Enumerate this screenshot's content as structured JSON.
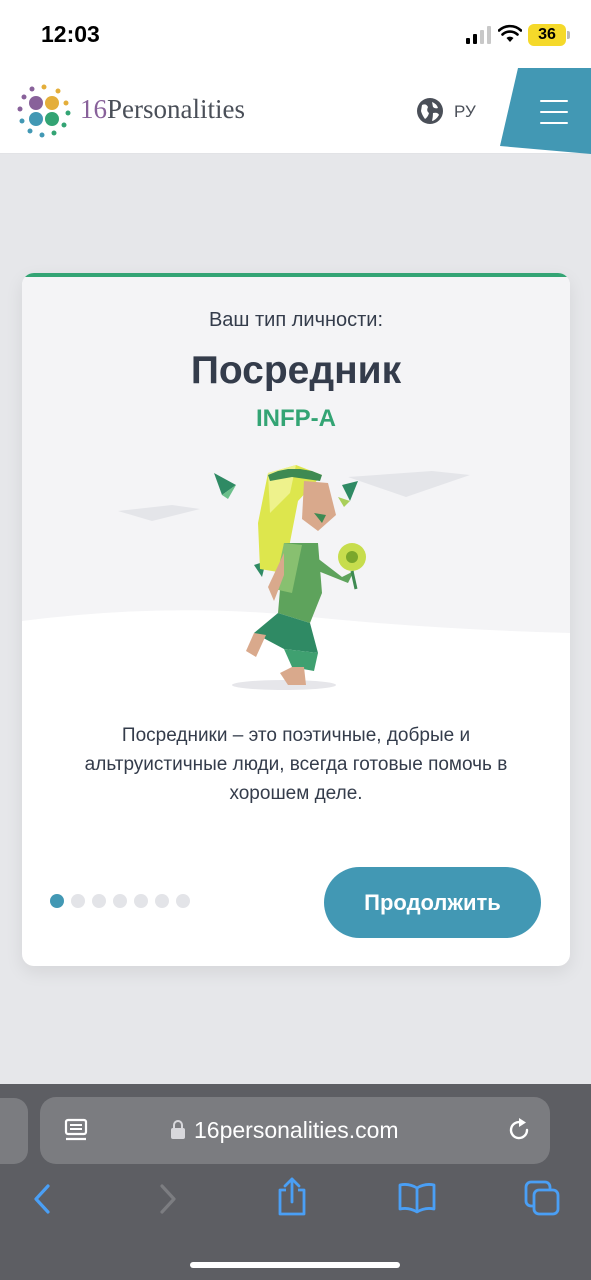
{
  "status_bar": {
    "time": "12:03",
    "battery": "36"
  },
  "header": {
    "logo_number": "16",
    "logo_word": "Personalities",
    "language": "РУ"
  },
  "card": {
    "subtitle": "Ваш тип личности:",
    "title": "Посредник",
    "type_code": "INFP-A",
    "description": "Посредники – это поэтичные, добрые и альтруистичные люди, всегда готовые помочь в хорошем деле.",
    "pager_total": 7,
    "pager_active": 1,
    "continue_label": "Продолжить"
  },
  "browser": {
    "url": "16personalities.com"
  },
  "colors": {
    "accent_green": "#33a474",
    "accent_blue": "#4298b4",
    "text_dark": "#343c4b"
  }
}
